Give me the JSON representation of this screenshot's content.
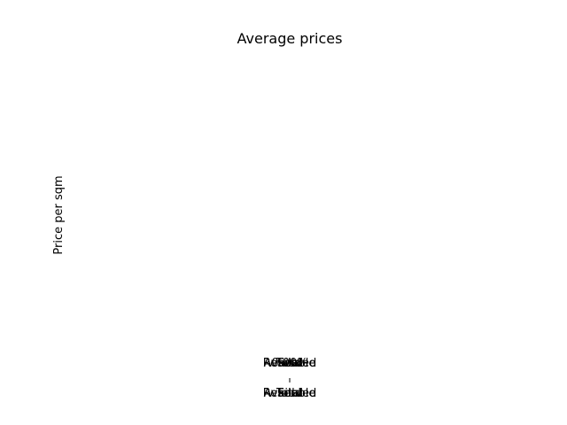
{
  "chart_data": {
    "type": "bar",
    "title": "Average prices",
    "xlabel": "",
    "ylabel": "Price per sqm",
    "categories": [
      "Available",
      "Reserved",
      "Sold",
      "Total"
    ],
    "series": [
      {
        "name": "Available",
        "values": [
          0
        ]
      },
      {
        "name": "Reserved",
        "values": [
          0
        ]
      },
      {
        "name": "Sold",
        "values": [
          0
        ]
      },
      {
        "name": "Total",
        "values": [
          0
        ]
      }
    ],
    "data_labels": [
      "Available",
      "Reserved",
      "Sold",
      "Total",
      "0.00%"
    ],
    "grid": false,
    "legend": "none"
  }
}
